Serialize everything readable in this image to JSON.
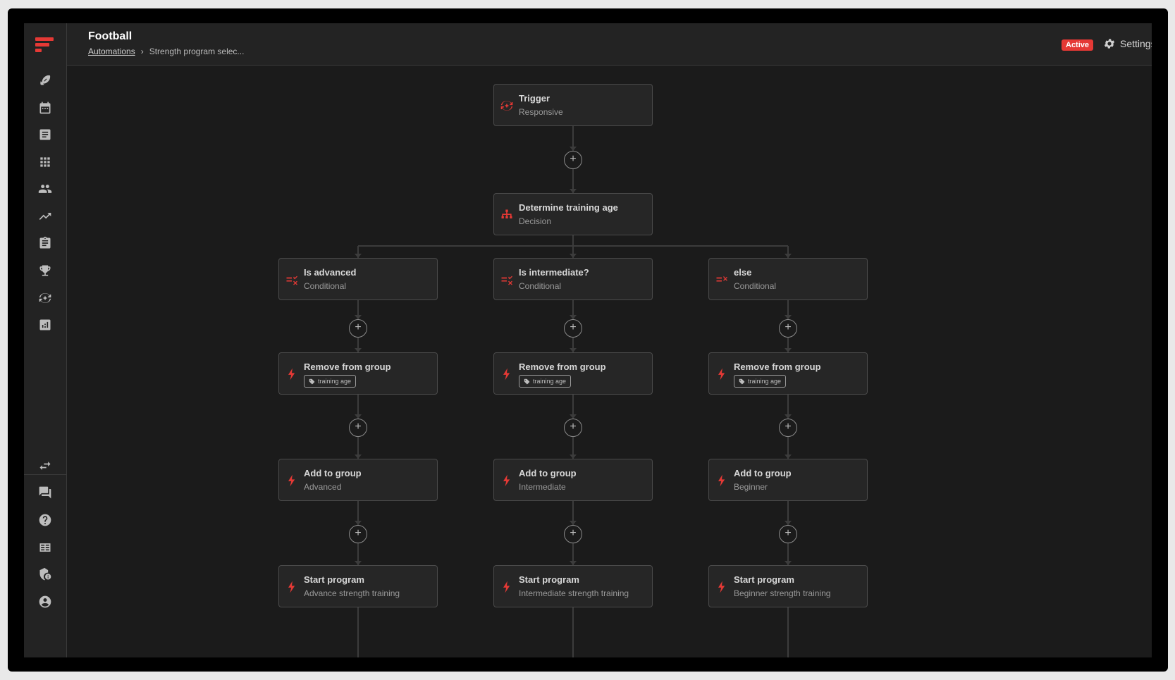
{
  "header": {
    "title": "Football",
    "breadcrumb_link": "Automations",
    "breadcrumb_separator": "›",
    "breadcrumb_current": "Strength program selec...",
    "status": "Active",
    "settings_label": "Settings"
  },
  "sidebar": {
    "top_items": [
      "football-icon",
      "calendar-icon",
      "notes-icon",
      "apps-grid-icon",
      "people-icon",
      "trending-icon",
      "clipboard-icon",
      "trophy-icon",
      "automation-icon",
      "analytics-icon"
    ],
    "bottom_items": [
      "swap-icon",
      "chat-icon",
      "help-icon",
      "library-icon",
      "security-icon",
      "account-icon"
    ]
  },
  "colors": {
    "accent": "#e53935",
    "background": "#1b1b1b",
    "panel": "#232323",
    "node": "#262626",
    "border": "#4a4a4a"
  },
  "add_button_label": "+",
  "flow": {
    "trigger": {
      "title": "Trigger",
      "subtitle": "Responsive",
      "icon": "trigger-icon"
    },
    "decision": {
      "title": "Determine training age",
      "subtitle": "Decision",
      "icon": "decision-icon"
    },
    "branches": [
      {
        "conditional": {
          "title": "Is advanced",
          "subtitle": "Conditional"
        },
        "remove": {
          "title": "Remove from group",
          "tag": "training age"
        },
        "add": {
          "title": "Add to group",
          "subtitle": "Advanced"
        },
        "start": {
          "title": "Start program",
          "subtitle": "Advance strength training"
        }
      },
      {
        "conditional": {
          "title": "Is intermediate?",
          "subtitle": "Conditional"
        },
        "remove": {
          "title": "Remove from group",
          "tag": "training age"
        },
        "add": {
          "title": "Add to group",
          "subtitle": "Intermediate"
        },
        "start": {
          "title": "Start program",
          "subtitle": "Intermediate strength training"
        }
      },
      {
        "conditional": {
          "title": "else",
          "subtitle": "Conditional"
        },
        "remove": {
          "title": "Remove from group",
          "tag": "training age"
        },
        "add": {
          "title": "Add to group",
          "subtitle": "Beginner"
        },
        "start": {
          "title": "Start program",
          "subtitle": "Beginner strength training"
        }
      }
    ]
  }
}
